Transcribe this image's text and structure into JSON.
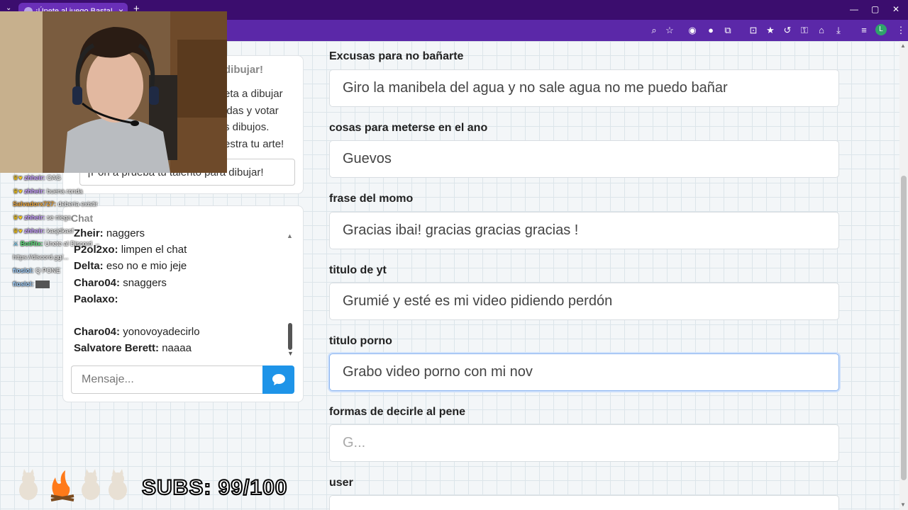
{
  "browser": {
    "tab_title": "¡Únete al juego Basta!",
    "icons": [
      "zoom-icon",
      "star-icon",
      "extension-icon",
      "download-icon",
      "menu-icon"
    ],
    "profile_initial": "L"
  },
  "draw_card": {
    "title": "dibujar!",
    "text_lines": [
      "eta a dibujar",
      "idas y votar",
      "s dibujos.",
      "estra tu arte!"
    ],
    "button_label": "¡Pon a prueba tu talento para dibujar!"
  },
  "chat": {
    "title": "Chat",
    "messages": [
      {
        "user": "Zheir:",
        "text": "naggers"
      },
      {
        "user": "P2ol2xo:",
        "text": "limpen el chat"
      },
      {
        "user": "Delta:",
        "text": "eso no e mio jeje"
      },
      {
        "user": "Charo04:",
        "text": "snaggers"
      },
      {
        "user": "Paolaxo:",
        "text": ""
      },
      {
        "user": "",
        "text": ""
      },
      {
        "user": "Charo04:",
        "text": "yonovoyadecirlo"
      },
      {
        "user": "Salvatore Berett:",
        "text": "naaaa"
      }
    ],
    "input_placeholder": "Mensaje..."
  },
  "stream_chat": [
    {
      "user": "zhheir:",
      "text": "OAG"
    },
    {
      "user": "zhheir:",
      "text": "buena ronda"
    },
    {
      "user": "Salvadorx727:",
      "text": "deberia existir"
    },
    {
      "user": "zhheir:",
      "text": "se niega"
    },
    {
      "user": "zhheir:",
      "text": "kasjdkasf"
    },
    {
      "user": "BotRix:",
      "text": "Unete al Discord →"
    },
    {
      "user": "https://discord.gg/...",
      "text": ""
    },
    {
      "user": "fioslol:",
      "text": "Q PONE"
    },
    {
      "user": "fioslol:",
      "text": ""
    }
  ],
  "subs": "SUBS: 99/100",
  "form": {
    "fields": [
      {
        "label": "Excusas para no bañarte",
        "value": "Giro la manibela del agua y no sale agua no me puedo bañar",
        "placeholder": ""
      },
      {
        "label": "cosas para meterse en el ano",
        "value": "Guevos",
        "placeholder": ""
      },
      {
        "label": "frase del momo",
        "value": "Gracias ibai! gracias gracias gracias !",
        "placeholder": ""
      },
      {
        "label": "titulo de yt",
        "value": "Grumié y esté es mi video pidiendo perdón",
        "placeholder": ""
      },
      {
        "label": "titulo porno",
        "value": "Grabo video porno con mi nov",
        "placeholder": ""
      },
      {
        "label": "formas de decirle al pene",
        "value": "",
        "placeholder": "G..."
      },
      {
        "label": "user",
        "value": "",
        "placeholder": ""
      }
    ]
  },
  "colors": {
    "accent": "#1e94e8",
    "chrome": "#5b28a8",
    "tabbar": "#3b0d6e"
  }
}
